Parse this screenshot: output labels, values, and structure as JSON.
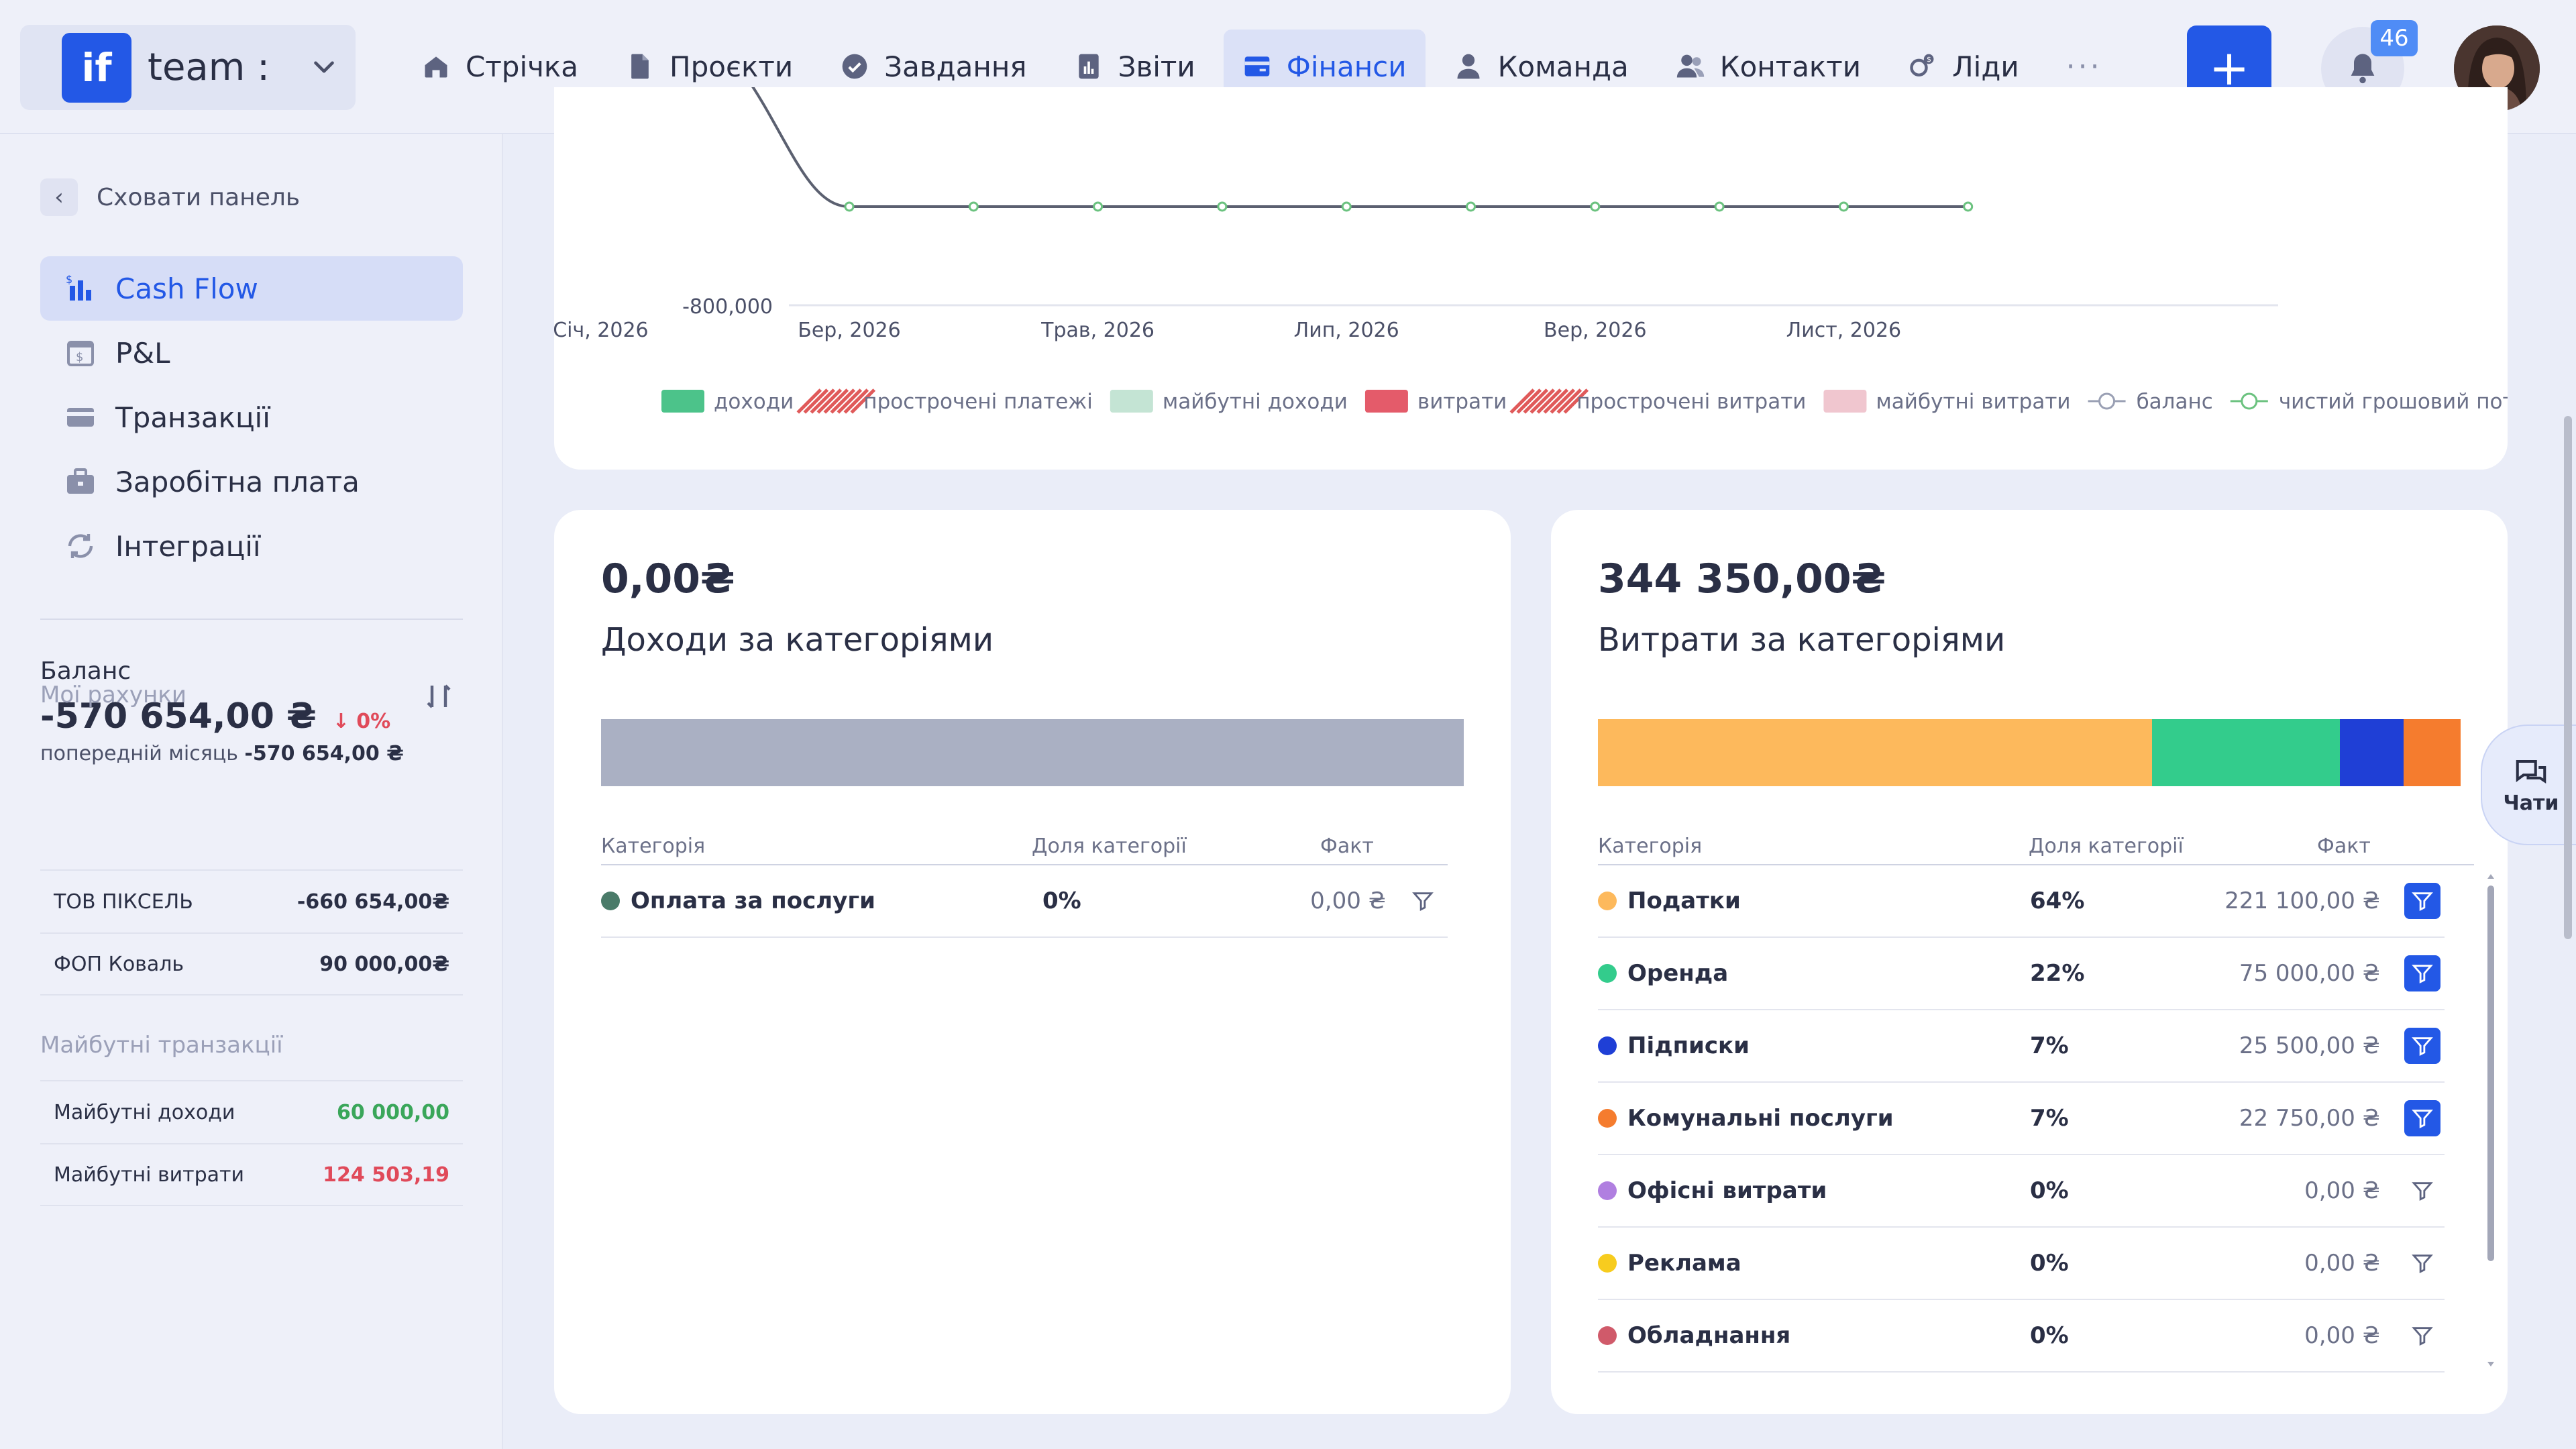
{
  "header": {
    "logo_text": "if",
    "team_name": "team :",
    "nav": [
      {
        "label": "Стрічка",
        "icon": "home-icon"
      },
      {
        "label": "Проєкти",
        "icon": "file-icon"
      },
      {
        "label": "Завдання",
        "icon": "check-circle-icon"
      },
      {
        "label": "Звіти",
        "icon": "report-icon"
      },
      {
        "label": "Фінанси",
        "icon": "wallet-icon",
        "active": true
      },
      {
        "label": "Команда",
        "icon": "person-icon"
      },
      {
        "label": "Контакти",
        "icon": "contacts-icon"
      },
      {
        "label": "Ліди",
        "icon": "leads-icon"
      }
    ],
    "more_label": "···",
    "plus_label": "+",
    "notifications_count": "46"
  },
  "sidebar": {
    "hide_label": "Сховати панель",
    "items": [
      {
        "label": "Cash Flow",
        "icon": "cashflow-icon",
        "active": true
      },
      {
        "label": "P&L",
        "icon": "calendar-dollar-icon"
      },
      {
        "label": "Транзакції",
        "icon": "card-icon"
      },
      {
        "label": "Заробітна плата",
        "icon": "briefcase-icon"
      },
      {
        "label": "Інтеграції",
        "icon": "sync-icon"
      }
    ],
    "balance": {
      "label": "Баланс",
      "value": "-570 654,00 ₴",
      "delta": "↓ 0%",
      "prev_label": "попередній місяць",
      "prev_value": "-570 654,00 ₴"
    },
    "accounts": {
      "title": "Мої рахунки",
      "rows": [
        {
          "name": "ТОВ ПІКСЕЛЬ",
          "value": "-660 654,00₴"
        },
        {
          "name": "ФОП Коваль",
          "value": "90 000,00₴"
        }
      ]
    },
    "future": {
      "title": "Майбутні транзакції",
      "rows": [
        {
          "name": "Майбутні доходи",
          "value": "60 000,00"
        },
        {
          "name": "Майбутні витрати",
          "value": "124 503,19"
        }
      ]
    }
  },
  "chart_data": {
    "type": "line",
    "title": "",
    "ylabel": "",
    "xlabel": "",
    "y_tick_label": "-800,000",
    "x_ticks": [
      "Січ, 2026",
      "Бер, 2026",
      "Трав, 2026",
      "Лип, 2026",
      "Вер, 2026",
      "Лист, 2026"
    ],
    "legend": [
      {
        "label": "доходи",
        "color": "#4cc38a",
        "style": "solid"
      },
      {
        "label": "прострочені платежі",
        "color": "#e05a5a",
        "style": "hatched"
      },
      {
        "label": "майбутні доходи",
        "color": "#c4e4d4",
        "style": "solid"
      },
      {
        "label": "витрати",
        "color": "#e45b6a",
        "style": "solid"
      },
      {
        "label": "прострочені витрати",
        "color": "#e05a5a",
        "style": "hatched"
      },
      {
        "label": "майбутні витрати",
        "color": "#f0c6cf",
        "style": "solid"
      },
      {
        "label": "баланс",
        "color": "#9aa0b4",
        "style": "line-marker"
      },
      {
        "label": "чистий грошовий потік",
        "color": "#6bc27f",
        "style": "line-marker"
      }
    ],
    "series": [
      {
        "name": "баланс",
        "x": [
          "Бер, 2026",
          "Кві, 2026",
          "Трав, 2026",
          "Чер, 2026",
          "Лип, 2026",
          "Сер, 2026",
          "Вер, 2026",
          "Жов, 2026",
          "Лист, 2026",
          "Гру, 2026"
        ]
      }
    ]
  },
  "income": {
    "total": "0,00₴",
    "title": "Доходи за категоріями",
    "bar": [
      {
        "color": "#aab0c3",
        "share": 100
      }
    ],
    "headers": {
      "category": "Категорія",
      "share": "Доля категорії",
      "fact": "Факт"
    },
    "rows": [
      {
        "name": "Оплата за послуги",
        "color": "#4a7b69",
        "share": "0%",
        "fact": "0,00 ₴",
        "filter_on": false
      }
    ]
  },
  "expense": {
    "total": "344 350,00₴",
    "title": "Витрати за категоріями",
    "bar": [
      {
        "color": "#fdb95c",
        "share": 64.2
      },
      {
        "color": "#33cc8c",
        "share": 21.8
      },
      {
        "color": "#1f3fd6",
        "share": 7.4
      },
      {
        "color": "#f57c2e",
        "share": 6.6
      }
    ],
    "headers": {
      "category": "Категорія",
      "share": "Доля категорії",
      "fact": "Факт"
    },
    "rows": [
      {
        "name": "Податки",
        "color": "#fdb95c",
        "share": "64%",
        "fact": "221 100,00 ₴",
        "filter_on": true
      },
      {
        "name": "Оренда",
        "color": "#33cc8c",
        "share": "22%",
        "fact": "75 000,00 ₴",
        "filter_on": true
      },
      {
        "name": "Підписки",
        "color": "#1f3fd6",
        "share": "7%",
        "fact": "25 500,00 ₴",
        "filter_on": true
      },
      {
        "name": "Комунальні послуги",
        "color": "#f57c2e",
        "share": "7%",
        "fact": "22 750,00 ₴",
        "filter_on": true
      },
      {
        "name": "Офісні витрати",
        "color": "#b07fe0",
        "share": "0%",
        "fact": "0,00 ₴",
        "filter_on": false
      },
      {
        "name": "Реклама",
        "color": "#f7cc1e",
        "share": "0%",
        "fact": "0,00 ₴",
        "filter_on": false
      },
      {
        "name": "Обладнання",
        "color": "#d05a6a",
        "share": "0%",
        "fact": "0,00 ₴",
        "filter_on": false
      }
    ]
  },
  "chat": {
    "label": "Чати"
  }
}
